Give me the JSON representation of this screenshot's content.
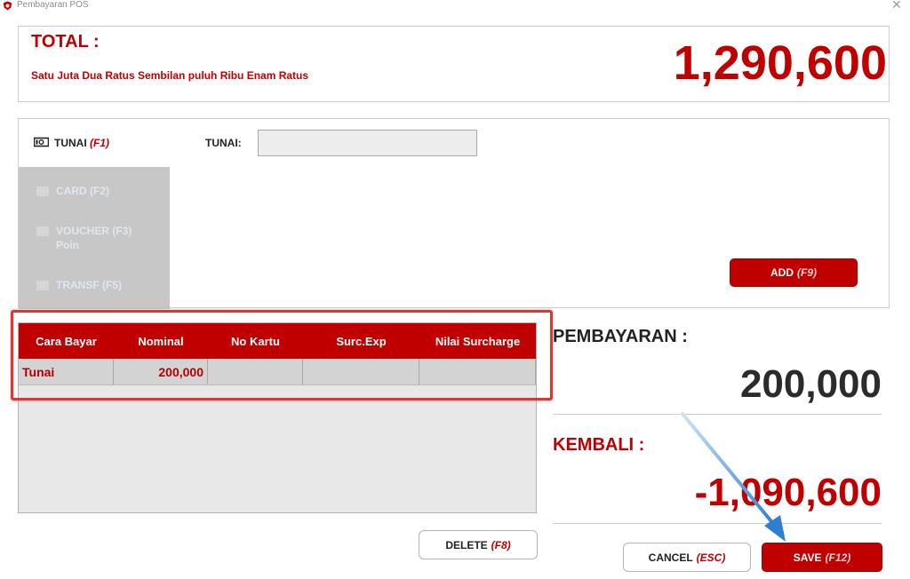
{
  "window": {
    "title": "Pembayaran POS",
    "close_glyph": "✕",
    "app_icon": "shield-logo-icon"
  },
  "total": {
    "label": "TOTAL :",
    "in_words": "Satu Juta Dua Ratus Sembilan puluh Ribu Enam Ratus",
    "amount": "1,290,600"
  },
  "methods": {
    "active": {
      "label": "TUNAI",
      "key": "(F1)",
      "icon": "cash-icon"
    },
    "disabled": [
      {
        "label": "CARD (F2)",
        "icon": "card-icon"
      },
      {
        "label": "VOUCHER (F3)",
        "icon": "voucher-icon"
      },
      {
        "label": "Poin",
        "icon": "voucher-icon"
      },
      {
        "label": "TRANSF (F5)",
        "icon": "transfer-icon"
      }
    ],
    "tunai_field_label": "TUNAI:",
    "tunai_value": "",
    "add_button": {
      "label": "ADD",
      "key": "(F9)"
    }
  },
  "payments_table": {
    "columns": [
      "Cara Bayar",
      "Nominal",
      "No Kartu",
      "Surc.Exp",
      "Nilai Surcharge"
    ],
    "rows": [
      {
        "cara_bayar": "Tunai",
        "nominal": "200,000",
        "no_kartu": "",
        "surc_exp": "",
        "nilai_surcharge": ""
      }
    ]
  },
  "delete_button": {
    "label": "DELETE",
    "key": "(F8)"
  },
  "summary": {
    "pembayaran_label": "PEMBAYARAN :",
    "pembayaran_amount": "200,000",
    "kembali_label": "KEMBALI :",
    "kembali_amount": "-1,090,600"
  },
  "cancel_button": {
    "label": "CANCEL",
    "key": "(ESC)"
  },
  "save_button": {
    "label": "SAVE",
    "key": "(F12)"
  },
  "colors": {
    "accent": "#c00000",
    "highlight": "#e3342f",
    "arrow": "#3a8ad6"
  }
}
